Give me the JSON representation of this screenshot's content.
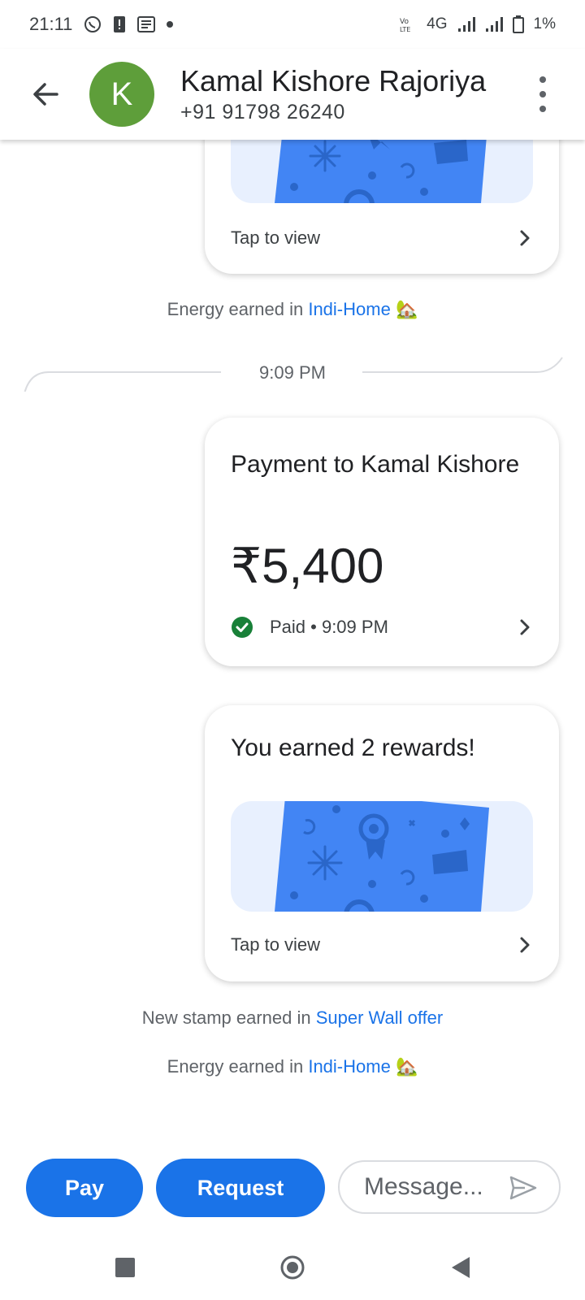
{
  "status_bar": {
    "time": "21:11",
    "network": "4G",
    "battery": "1%"
  },
  "header": {
    "avatar_letter": "K",
    "name": "Kamal Kishore Rajoriya",
    "phone": "+91 91798 26240"
  },
  "chat": {
    "top_card": {
      "tap_label": "Tap to view"
    },
    "energy_text_1": {
      "prefix": "Energy earned in ",
      "link": "Indi-Home",
      "emoji": "🏡"
    },
    "time_divider": "9:09 PM",
    "payment_card": {
      "title": "Payment to Kamal Kishore",
      "amount": "₹5,400",
      "status": "Paid • 9:09 PM"
    },
    "reward_card": {
      "title": "You earned 2 rewards!",
      "tap_label": "Tap to view"
    },
    "stamp_text": {
      "prefix": "New stamp earned in ",
      "link": "Super Wall offer"
    },
    "energy_text_2": {
      "prefix": "Energy earned in ",
      "link": "Indi-Home",
      "emoji": "🏡"
    }
  },
  "compose": {
    "pay_label": "Pay",
    "request_label": "Request",
    "message_placeholder": "Message..."
  },
  "colors": {
    "accent": "#1a73e8",
    "avatar": "#5e9e3a",
    "paid_green": "#188038",
    "reward_blue": "#4285f4",
    "reward_bg": "#e8f0fe"
  },
  "icons": {
    "back": "arrow-left-icon",
    "more": "more-vert-icon",
    "chevron": "chevron-right-icon",
    "check": "check-circle-icon",
    "send": "send-icon",
    "nav_recents": "square-icon",
    "nav_home": "circle-icon",
    "nav_back": "triangle-icon"
  }
}
